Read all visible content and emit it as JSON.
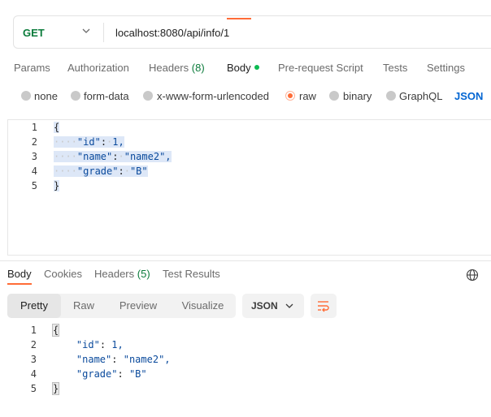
{
  "request": {
    "method": "GET",
    "url": "localhost:8080/api/info/1"
  },
  "request_tabs": {
    "params": "Params",
    "authorization": "Authorization",
    "headers": "Headers",
    "headers_count": "(8)",
    "body": "Body",
    "prerequest": "Pre-request Script",
    "tests": "Tests",
    "settings": "Settings"
  },
  "body_types": {
    "none": "none",
    "form_data": "form-data",
    "urlencoded": "x-www-form-urlencoded",
    "raw": "raw",
    "binary": "binary",
    "graphql": "GraphQL",
    "format": "JSON"
  },
  "request_body": {
    "line_numbers": [
      "1",
      "2",
      "3",
      "4",
      "5"
    ],
    "open_brace": "{",
    "close_brace": "}",
    "fields": [
      {
        "key": "\"id\"",
        "value": "1,"
      },
      {
        "key": "\"name\"",
        "value": "\"name2\","
      },
      {
        "key": "\"grade\"",
        "value": "\"B\""
      }
    ]
  },
  "response_tabs": {
    "body": "Body",
    "cookies": "Cookies",
    "headers": "Headers",
    "headers_count": "(5)",
    "test_results": "Test Results"
  },
  "response_view": {
    "pretty": "Pretty",
    "raw": "Raw",
    "preview": "Preview",
    "visualize": "Visualize",
    "format": "JSON"
  },
  "response_body": {
    "line_numbers": [
      "1",
      "2",
      "3",
      "4",
      "5"
    ],
    "open_brace": "{",
    "close_brace": "}",
    "fields": [
      {
        "key": "\"id\"",
        "value": "1,"
      },
      {
        "key": "\"name\"",
        "value": "\"name2\","
      },
      {
        "key": "\"grade\"",
        "value": "\"B\""
      }
    ]
  },
  "colors": {
    "accent": "#ff6c37",
    "method": "#0b7b3b",
    "link": "#0265d2",
    "selection": "#dde7f7"
  },
  "icons": [
    "chevron-down-icon",
    "globe-icon",
    "wrap-lines-icon"
  ]
}
